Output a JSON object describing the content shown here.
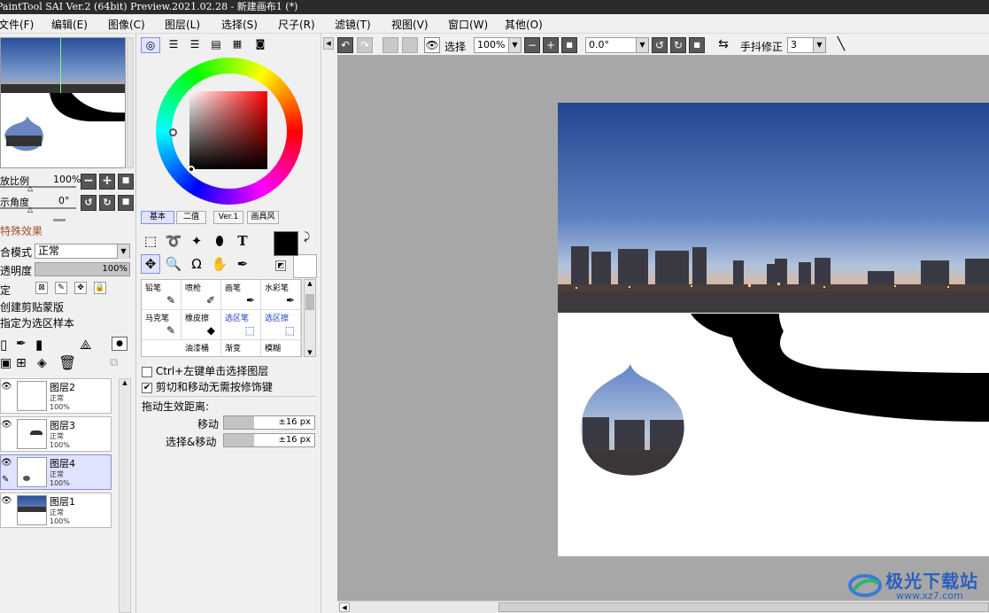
{
  "app": {
    "title": "PaintTool SAI Ver.2 (64bit) Preview.2021.02.28 - 新建画布1 (*)"
  },
  "menu": [
    "文件(F)",
    "编辑(E)",
    "图像(C)",
    "图层(L)",
    "选择(S)",
    "尺子(R)",
    "滤镜(T)",
    "视图(V)",
    "窗口(W)",
    "其他(O)"
  ],
  "navigator": {
    "zoom_label": "放比例",
    "zoom_value": "100%",
    "angle_label": "示角度",
    "angle_value": "0°"
  },
  "effects": {
    "title": "特殊效果"
  },
  "layer_props": {
    "blend_label": "合模式",
    "blend_value": "正常",
    "opacity_label": "透明度",
    "opacity_value": "100%",
    "lock_label": "定",
    "clip_label": "创建剪贴蒙版",
    "sample_label": "指定为选区样本"
  },
  "layers": [
    {
      "name": "图层2",
      "mode": "正常",
      "opacity": "100%"
    },
    {
      "name": "图层3",
      "mode": "正常",
      "opacity": "100%"
    },
    {
      "name": "图层4",
      "mode": "正常",
      "opacity": "100%"
    },
    {
      "name": "图层1",
      "mode": "正常",
      "opacity": "100%"
    }
  ],
  "color_tabs": [
    "基本",
    "二值",
    "Ver.1",
    "画具风"
  ],
  "brushes": [
    {
      "name": "铅笔",
      "icon": "pencil-icon"
    },
    {
      "name": "喷枪",
      "icon": "airbrush-icon"
    },
    {
      "name": "画笔",
      "icon": "brush-icon"
    },
    {
      "name": "水彩笔",
      "icon": "watercolor-icon"
    },
    {
      "name": "马克笔",
      "icon": "marker-icon"
    },
    {
      "name": "橡皮擦",
      "icon": "eraser-icon"
    },
    {
      "name": "选区笔",
      "icon": "selpen-icon"
    },
    {
      "name": "选区擦",
      "icon": "selerase-icon"
    },
    {
      "name": "油漆桶",
      "icon": "bucket-icon"
    },
    {
      "name": "渐变",
      "icon": "gradient-icon"
    },
    {
      "name": "模糊",
      "icon": "blur-icon"
    }
  ],
  "tool_options": {
    "ctrl_click_label": "Ctrl+左键单击选择图层",
    "ctrl_click_checked": false,
    "cut_move_label": "剪切和移动无需按修饰键",
    "cut_move_checked": true,
    "drag_label": "拖动生效距离:",
    "move_label": "移动",
    "move_value": "±16 px",
    "select_move_label": "选择&移动",
    "select_move_value": "±16 px"
  },
  "toolbar": {
    "select_label": "选择",
    "zoom_value": "100%",
    "angle_value": "0.0°",
    "stabilizer_label": "手抖修正",
    "stabilizer_value": "3"
  },
  "watermark": {
    "text": "极光下载站",
    "url": "www.xz7.com"
  },
  "colors": {
    "accent": "#5a64c8",
    "foreground_color": "#000000",
    "background_color": "#ffffff"
  }
}
